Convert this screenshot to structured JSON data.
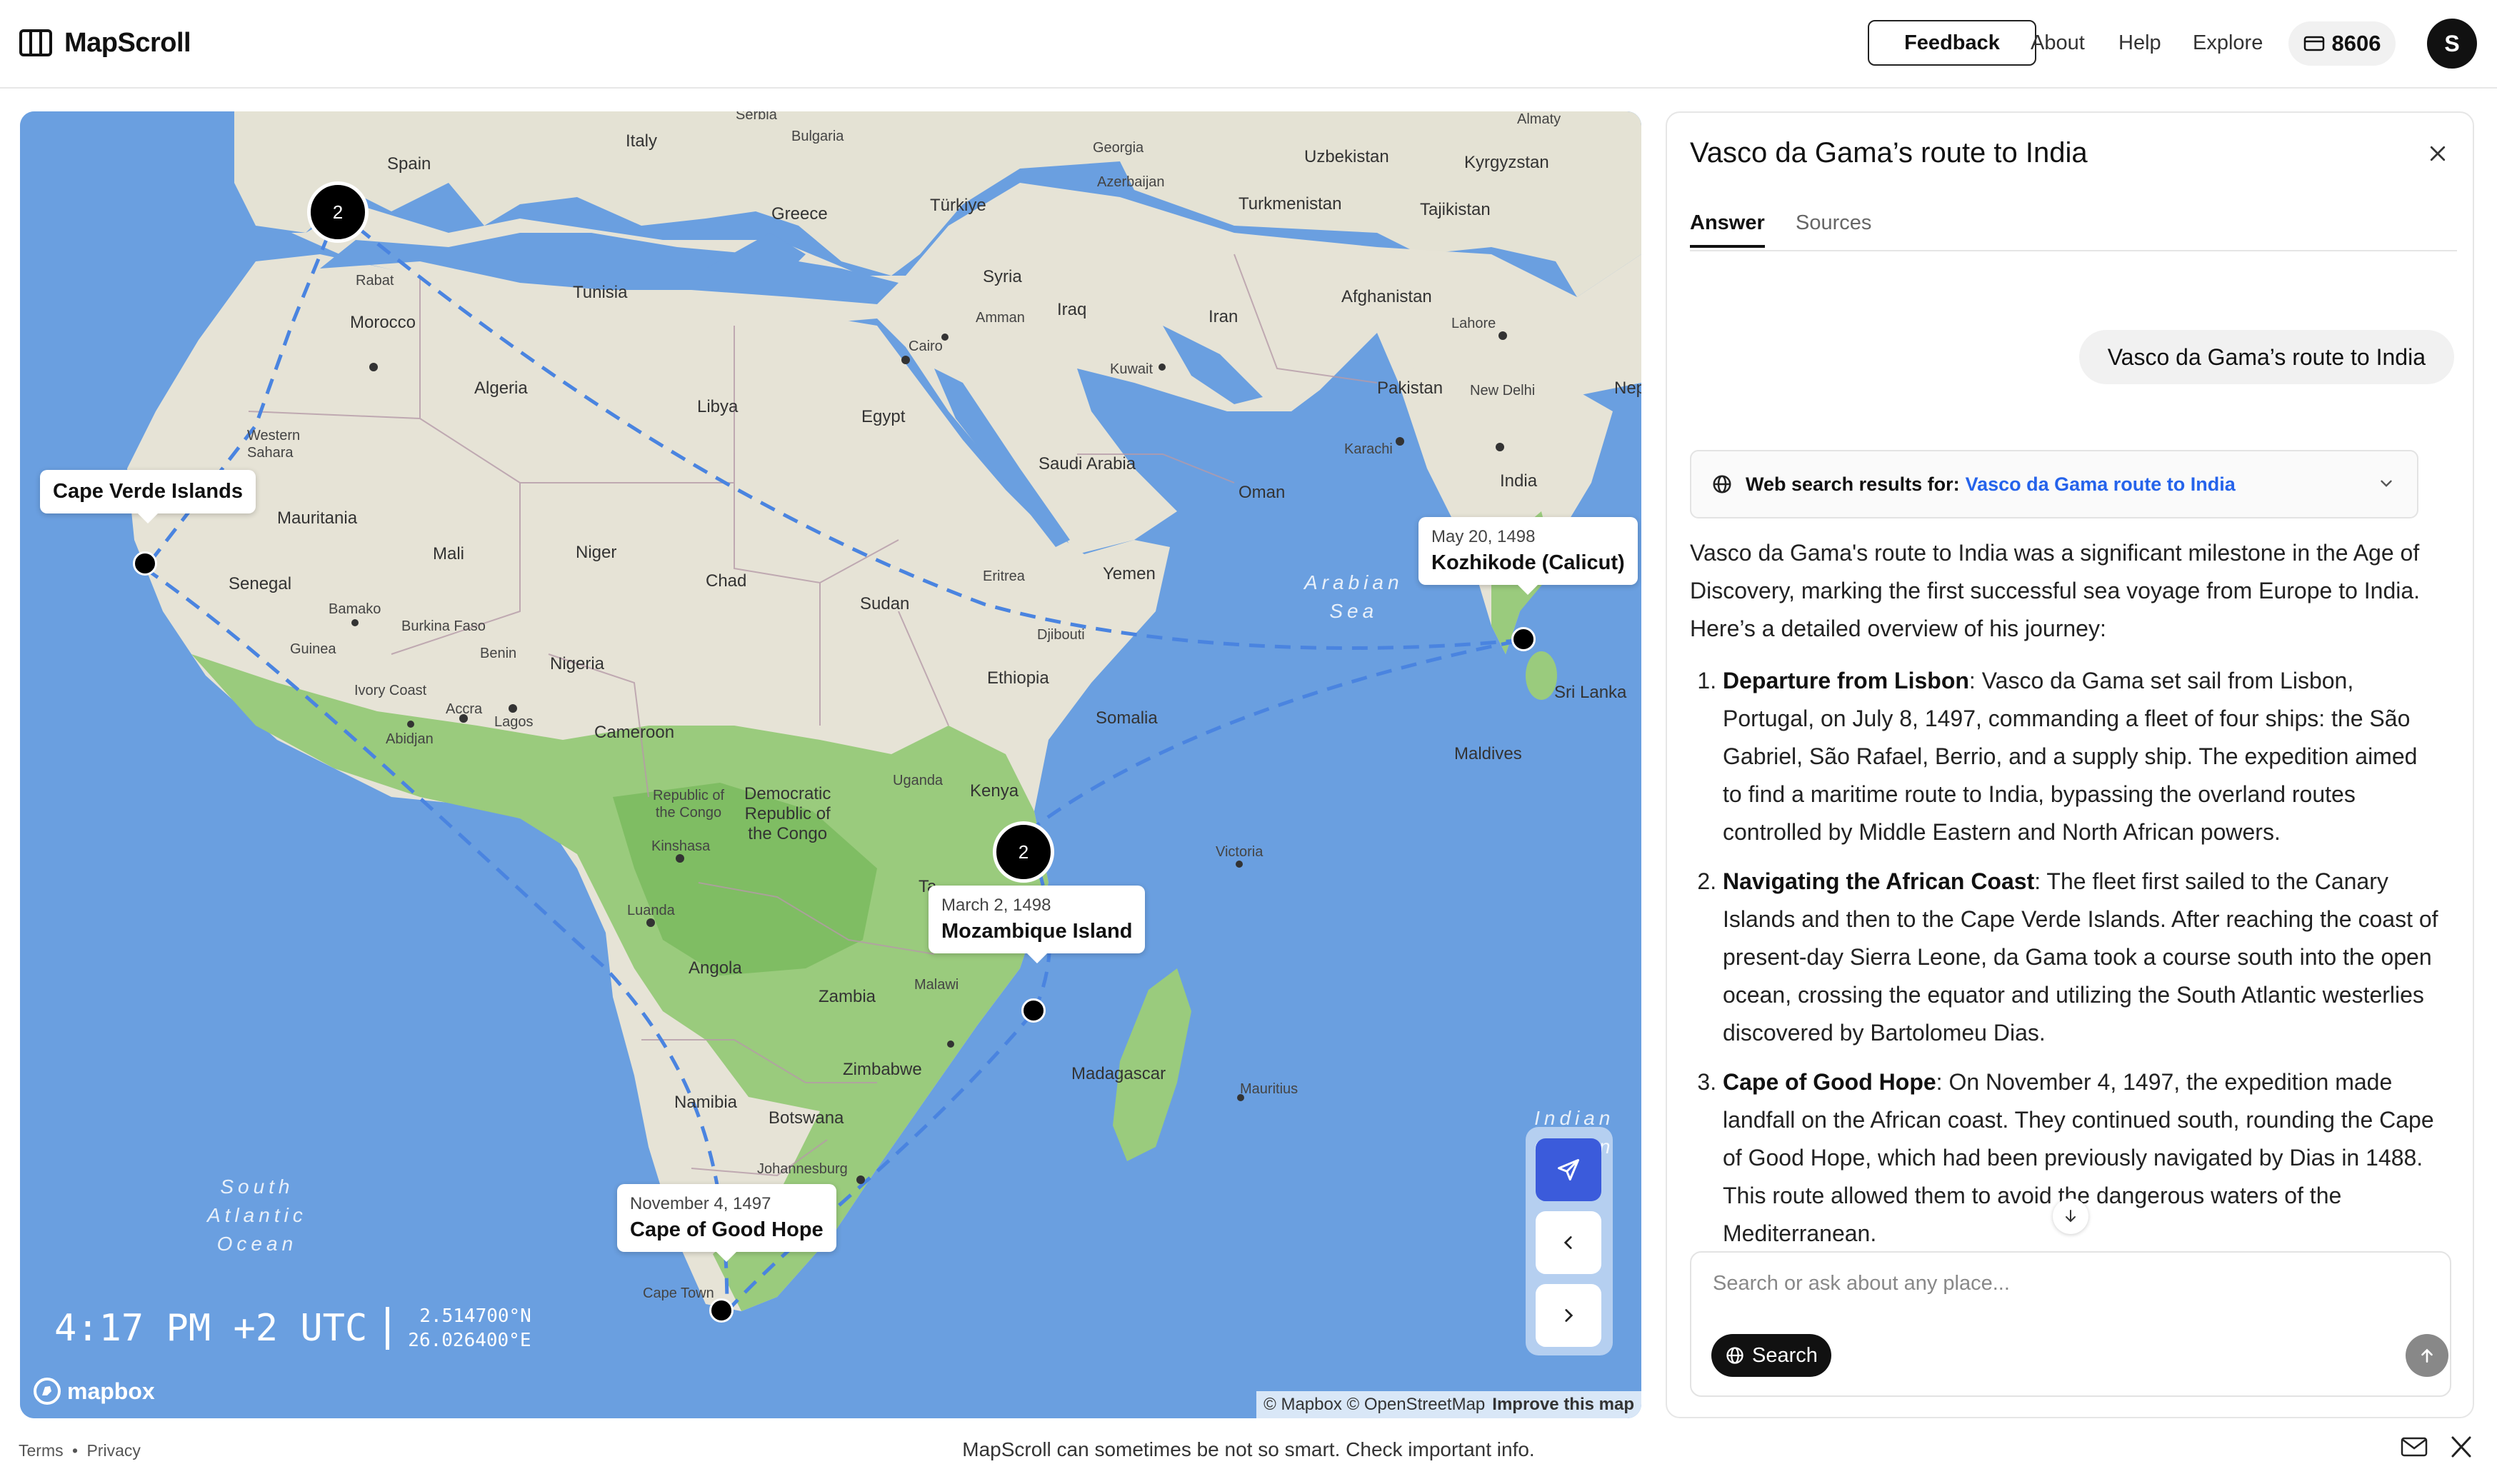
{
  "header": {
    "app_name": "MapScroll",
    "feedback_label": "Feedback",
    "nav": [
      "About",
      "Help",
      "Explore"
    ],
    "credits": "8606",
    "avatar_initial": "S"
  },
  "map": {
    "countries": {
      "spain": "Spain",
      "italy": "Italy",
      "bulgaria": "Bulgaria",
      "serbia": "Serbia",
      "georgia": "Georgia",
      "uzbekistan": "Uzbekistan",
      "kyrgyzstan": "Kyrgyzstan",
      "almaty": "Almaty",
      "greece": "Greece",
      "turkiye": "Türkiye",
      "azerbaijan": "Azerbaijan",
      "turkmenistan": "Turkmenistan",
      "tajikistan": "Tajikistan",
      "rabat": "Rabat",
      "tunisia": "Tunisia",
      "syria": "Syria",
      "iraq": "Iraq",
      "amman": "Amman",
      "morocco": "Morocco",
      "afghanistan": "Afghanistan",
      "lahore": "Lahore",
      "cairo": "Cairo",
      "iran": "Iran",
      "algeria": "Algeria",
      "libya": "Libya",
      "egypt": "Egypt",
      "kuwait": "Kuwait",
      "pakistan": "Pakistan",
      "new_delhi": "New Delhi",
      "nep": "Nep",
      "western_sahara": "Western\nSahara",
      "karachi": "Karachi",
      "saudi_arabia": "Saudi Arabia",
      "mauritania": "Mauritania",
      "oman": "Oman",
      "india": "India",
      "mali": "Mali",
      "niger": "Niger",
      "senegal": "Senegal",
      "chad": "Chad",
      "eritrea": "Eritrea",
      "yemen": "Yemen",
      "sudan": "Sudan",
      "bamako": "Bamako",
      "burkina_faso": "Burkina Faso",
      "djibouti": "Djibouti",
      "guinea": "Guinea",
      "benin": "Benin",
      "nigeria": "Nigeria",
      "ethiopia": "Ethiopia",
      "ivory_coast": "Ivory Coast",
      "accra": "Accra",
      "lagos": "Lagos",
      "abidjan": "Abidjan",
      "cameroon": "Cameroon",
      "somalia": "Somalia",
      "sri_lanka": "Sri Lanka",
      "maldives": "Maldives",
      "republic_congo": "Republic of\nthe Congo",
      "drc": "Democratic\nRepublic of\nthe Congo",
      "uganda": "Uganda",
      "kenya": "Kenya",
      "kinshasa": "Kinshasa",
      "victoria": "Victoria",
      "luanda": "Luanda",
      "angola": "Angola",
      "zambia": "Zambia",
      "malawi": "Malawi",
      "zimbabwe": "Zimbabwe",
      "madagascar": "Madagascar",
      "mauritius": "Mauritius",
      "namibia": "Namibia",
      "botswana": "Botswana",
      "johannesburg": "Johannesburg",
      "cape_town": "Cape Town",
      "tanzania_partial": "Ta"
    },
    "seas": {
      "arabian_sea": "Arabian\nSea",
      "south_atlantic": "South\nAtlantic\nOcean",
      "indian_ocean": "Indian\nOcean"
    },
    "clusters": [
      "2",
      "2"
    ],
    "popups": {
      "cape_verde": {
        "place": "Cape Verde Islands"
      },
      "calicut": {
        "date": "May 20, 1498",
        "place": "Kozhikode (Calicut)"
      },
      "mozambique": {
        "date": "March 2, 1498",
        "place": "Mozambique Island"
      },
      "good_hope": {
        "date": "November 4, 1497",
        "place": "Cape of Good Hope"
      }
    },
    "time": "4:17 PM +2 UTC",
    "lat": "2.514700°N",
    "lon": "26.026400°E",
    "mapbox_logo": "mapbox",
    "attribution": "© Mapbox © OpenStreetMap",
    "improve": "Improve this map",
    "controls": [
      "send-icon",
      "chevron-left-icon",
      "chevron-right-icon"
    ],
    "colors": {
      "water": "#6a9fe0",
      "land": "#e6e3d6",
      "vegetation": "#98c979",
      "route": "#4a84e0",
      "accent": "#3b5bdb"
    }
  },
  "panel": {
    "title": "Vasco da Gama’s route to India",
    "tabs": [
      "Answer",
      "Sources"
    ],
    "user_query": "Vasco da Gama’s route to India",
    "websearch_prefix": "Web search results for:",
    "websearch_query": "Vasco da Gama route to India",
    "intro": "Vasco da Gama's route to India was a significant milestone in the Age of Discovery, marking the first successful sea voyage from Europe to India. Here’s a detailed overview of his journey:",
    "items": [
      {
        "title": "Departure from Lisbon",
        "text": ": Vasco da Gama set sail from Lisbon, Portugal, on July 8, 1497, commanding a fleet of four ships: the São Gabriel, São Rafael, Berrio, and a supply ship. The expedition aimed to find a maritime route to India, bypassing the overland routes controlled by Middle Eastern and North African powers."
      },
      {
        "title": "Navigating the African Coast",
        "text": ": The fleet first sailed to the Canary Islands and then to the Cape Verde Islands. After reaching the coast of present-day Sierra Leone, da Gama took a course south into the open ocean, crossing the equator and utilizing the South Atlantic westerlies discovered by Bartolomeu Dias."
      },
      {
        "title": "Cape of Good Hope",
        "text": ": On November 4, 1497, the expedition made landfall on the African coast. They continued south, rounding the Cape of Good Hope, which had been previously navigated by Dias in 1488. This route allowed them to avoid the dangerous waters of the Mediterranean."
      }
    ],
    "search_placeholder": "Search or ask about any place...",
    "search_button": "Search"
  },
  "footer": {
    "terms": "Terms",
    "separator": "•",
    "privacy": "Privacy",
    "disclaimer": "MapScroll can sometimes be not so smart. Check important info."
  }
}
